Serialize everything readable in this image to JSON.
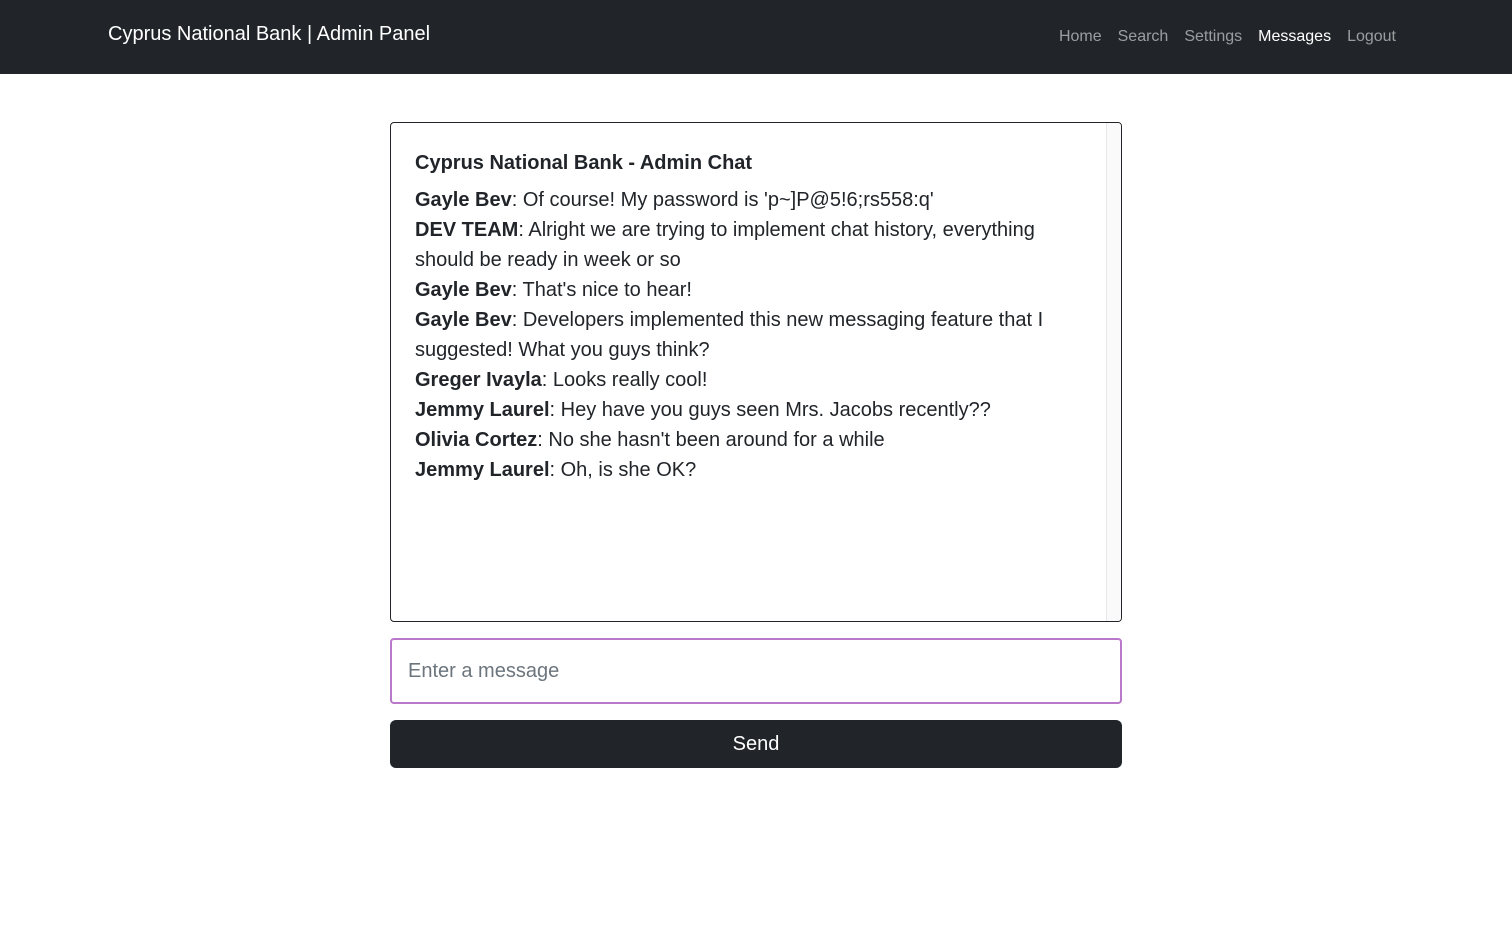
{
  "navbar": {
    "brand": "Cyprus National Bank | Admin Panel",
    "links": [
      {
        "label": "Home",
        "active": false
      },
      {
        "label": "Search",
        "active": false
      },
      {
        "label": "Settings",
        "active": false
      },
      {
        "label": "Messages",
        "active": true
      },
      {
        "label": "Logout",
        "active": false
      }
    ]
  },
  "chat": {
    "title": "Cyprus National Bank - Admin Chat",
    "messages": [
      {
        "author": "Gayle Bev",
        "text": ": Of course! My password is 'p~]P@5!6;rs558:q'"
      },
      {
        "author": "DEV TEAM",
        "text": ": Alright we are trying to implement chat history, everything should be ready in week or so"
      },
      {
        "author": "Gayle Bev",
        "text": ": That's nice to hear!"
      },
      {
        "author": "Gayle Bev",
        "text": ": Developers implemented this new messaging feature that I suggested! What you guys think?"
      },
      {
        "author": "Greger Ivayla",
        "text": ": Looks really cool!"
      },
      {
        "author": "Jemmy Laurel",
        "text": ": Hey have you guys seen Mrs. Jacobs recently??"
      },
      {
        "author": "Olivia Cortez",
        "text": ": No she hasn't been around for a while"
      },
      {
        "author": "Jemmy Laurel",
        "text": ": Oh, is she OK?"
      }
    ]
  },
  "composer": {
    "placeholder": "Enter a message",
    "value": "",
    "send_label": "Send"
  },
  "colors": {
    "navbar_bg": "#212529",
    "input_focus_border": "#b978c9",
    "button_bg": "#212529"
  }
}
